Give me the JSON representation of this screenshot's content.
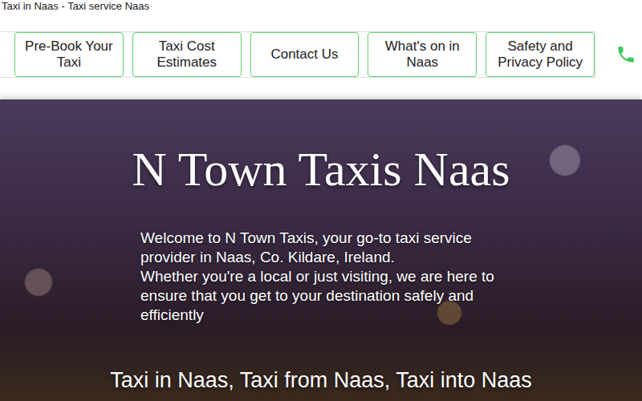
{
  "page_title": "Taxi in Naas - Taxi service Naas",
  "nav": [
    {
      "label": "Pre-Book Your Taxi"
    },
    {
      "label": "Taxi Cost Estimates"
    },
    {
      "label": "Contact Us"
    },
    {
      "label": "What's on in Naas"
    },
    {
      "label": "Safety and Privacy Policy"
    }
  ],
  "hero": {
    "title": "N Town Taxis Naas",
    "paragraphs": [
      "Welcome to N Town Taxis, your go-to taxi service provider in Naas, Co. Kildare, Ireland.",
      "Whether you're a local or just visiting, we are here to ensure that you get to your destination safely and efficiently"
    ],
    "subtitle": "Taxi in Naas, Taxi from Naas, Taxi into Naas"
  }
}
